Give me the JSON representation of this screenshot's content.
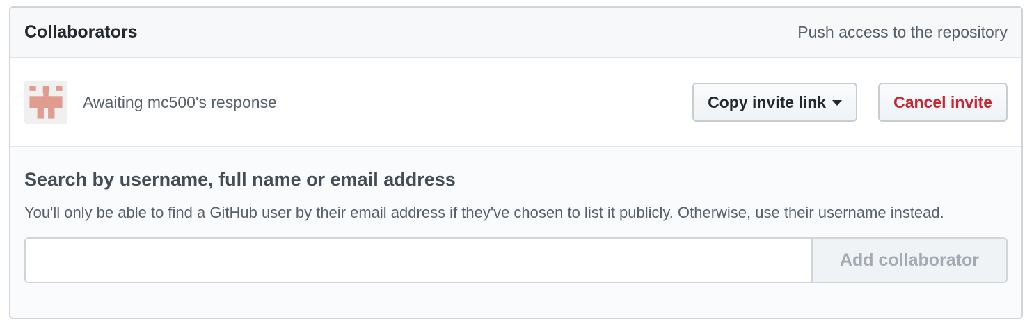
{
  "panel": {
    "title": "Collaborators",
    "note": "Push access to the repository"
  },
  "invite": {
    "status_text": "Awaiting mc500's response",
    "copy_label": "Copy invite link",
    "cancel_label": "Cancel invite",
    "avatar_color": "#e09c8e"
  },
  "search": {
    "heading": "Search by username, full name or email address",
    "help": "You'll only be able to find a GitHub user by their email address if they've chosen to list it publicly. Otherwise, use their username instead.",
    "input_value": "",
    "add_label": "Add collaborator"
  },
  "colors": {
    "danger": "#cb2431",
    "disabled_text": "#a3aab1"
  }
}
